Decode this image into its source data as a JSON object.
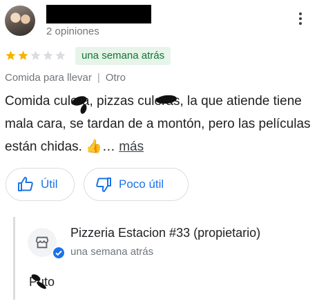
{
  "reviewer": {
    "reviews_count": "2 opiniones"
  },
  "rating": {
    "stars_filled": 2,
    "stars_total": 5,
    "date": "una semana atrás"
  },
  "meta": {
    "service": "Comida para llevar",
    "separator": "|",
    "category": "Otro"
  },
  "review": {
    "text": "Comida culera, pizzas culeras, la que atiende tiene mala cara, se tardan de a montón, pero las películas están chidas. 👍…",
    "more_label": "más"
  },
  "actions": {
    "useful_label": "Útil",
    "not_useful_label": "Poco útil"
  },
  "owner_reply": {
    "name": "Pizzeria Estacion #33 (propietario)",
    "date": "una semana atrás",
    "text": "Puto"
  },
  "colors": {
    "star_filled": "#f4b400",
    "star_empty": "#dadce0",
    "badge_bg": "#e6f4ea",
    "badge_text": "#137333",
    "accent": "#1a73e8"
  }
}
